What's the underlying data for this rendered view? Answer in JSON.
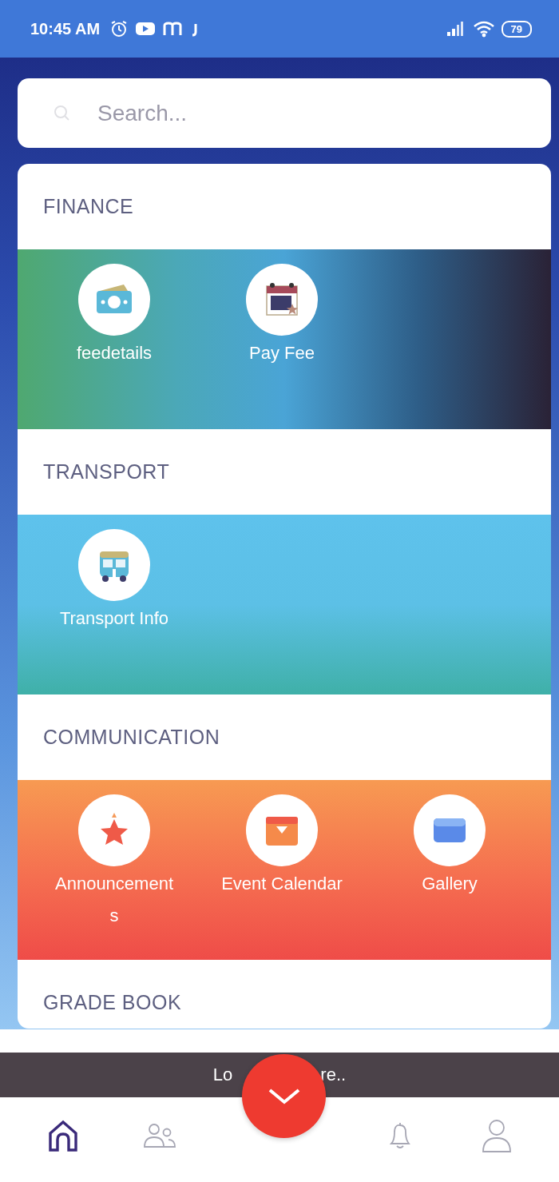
{
  "status_bar": {
    "time": "10:45 AM",
    "battery": "79"
  },
  "search": {
    "placeholder": "Search..."
  },
  "sections": [
    {
      "title": "FINANCE",
      "kind": "ocean",
      "items": [
        {
          "label": "feedetails",
          "kind": "money"
        },
        {
          "label": "Pay Fee",
          "kind": "calendar-star"
        }
      ]
    },
    {
      "title": "TRANSPORT",
      "kind": "sky",
      "items": [
        {
          "label": "Transport Info",
          "kind": "bus"
        }
      ]
    },
    {
      "title": "COMMUNICATION",
      "kind": "sunset",
      "items": [
        {
          "label": "Announcements",
          "kind": "star"
        },
        {
          "label": "Event Calendar",
          "kind": "calendar"
        },
        {
          "label": "Gallery",
          "kind": "gallery"
        }
      ]
    },
    {
      "title": "GRADE BOOK",
      "kind": "none"
    }
  ],
  "toast": {
    "text_before": "Lo",
    "text_after": "re.."
  },
  "nav": [
    {
      "kind": "home",
      "selected": true
    },
    {
      "kind": "people",
      "selected": false
    },
    {
      "kind": "bell",
      "selected": false
    },
    {
      "kind": "person",
      "selected": false
    }
  ]
}
